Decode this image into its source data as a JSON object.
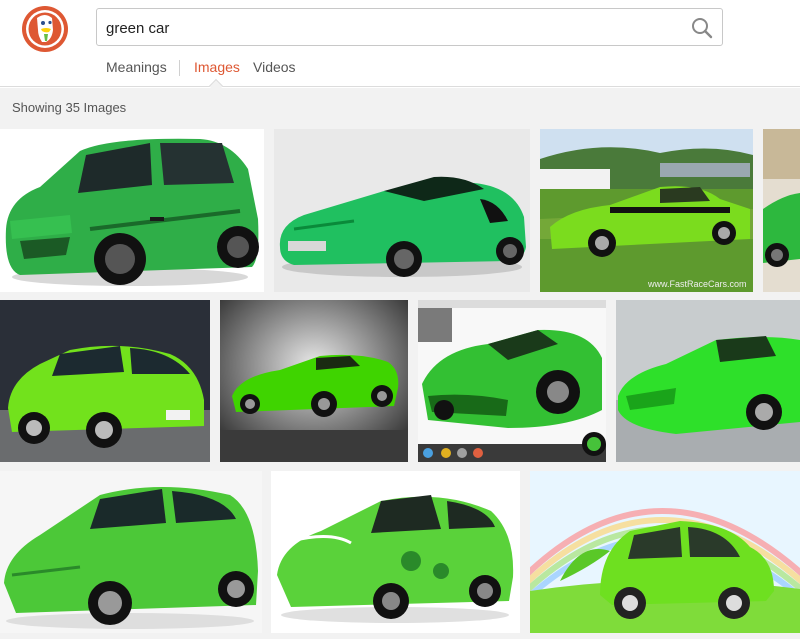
{
  "search": {
    "query": "green car"
  },
  "tabs": [
    {
      "label": "Meanings",
      "active": false
    },
    {
      "label": "Images",
      "active": true
    },
    {
      "label": "Videos",
      "active": false
    }
  ],
  "results": {
    "count_label": "Showing 35 Images",
    "images": [
      {
        "subject": "green hatchback"
      },
      {
        "subject": "green sports coupe"
      },
      {
        "subject": "lime green muscle car"
      },
      {
        "subject": "green car (partial)"
      },
      {
        "subject": "lime green compact car"
      },
      {
        "subject": "green convertible"
      },
      {
        "subject": "green sports car on desktop"
      },
      {
        "subject": "green supercar"
      },
      {
        "subject": "green concept car"
      },
      {
        "subject": "green hybrid car with floral wrap"
      },
      {
        "subject": "cartoon green car with rainbow"
      }
    ],
    "watermarks": {
      "fastrace": "www.FastRaceCars.com"
    }
  },
  "colors": {
    "accent": "#de5833",
    "result_bg": "#f2f2f2",
    "car_green": "#3cc43c"
  }
}
